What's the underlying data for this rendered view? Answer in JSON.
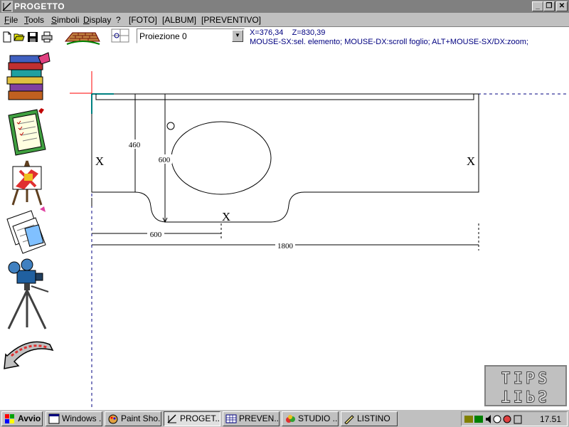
{
  "window": {
    "title": "PROGETTO",
    "minimize_glyph": "_",
    "restore_glyph": "❐",
    "close_glyph": "✕"
  },
  "menu": {
    "items": [
      {
        "label": "File"
      },
      {
        "label": "Tools"
      },
      {
        "label": "Simboli"
      },
      {
        "label": "Display"
      },
      {
        "label": "?"
      },
      {
        "label": "[FOTO]"
      },
      {
        "label": "[ALBUM]"
      },
      {
        "label": "[PREVENTIVO]"
      }
    ]
  },
  "toolbar": {
    "icons": [
      "new-file-icon",
      "open-folder-icon",
      "save-disk-icon",
      "print-icon",
      "brick-wall-icon",
      "projection-view-icon"
    ],
    "projection": "Proiezione 0"
  },
  "status": {
    "coords": "X=376,34    Z=830,39",
    "hint": "MOUSE-SX:sel. elemento; MOUSE-DX:scroll foglio; ALT+MOUSE-SX/DX:zoom;"
  },
  "sidebar": {
    "icons": [
      "catalog-books-icon",
      "clipboard-checklist-icon",
      "easel-drawing-icon",
      "papers-calculator-icon",
      "camera-tripod-icon",
      "back-arrow-icon"
    ]
  },
  "drawing": {
    "dim_460": "460",
    "dim_600_vertical": "600",
    "dim_600_horizontal": "600",
    "dim_1800": "1800",
    "marker": "X"
  },
  "logo_text": "TIPS",
  "taskbar": {
    "start": "Avvio",
    "tasks": [
      {
        "label": "Windows ..."
      },
      {
        "label": "Paint Sho..."
      },
      {
        "label": "PROGET..."
      },
      {
        "label": "PREVEN..."
      },
      {
        "label": "STUDIO ..."
      },
      {
        "label": "LISTINO"
      }
    ],
    "clock": "17.51"
  },
  "colors": {
    "accent_blue": "#000080",
    "title_gray": "#808080",
    "guide_red": "#ff0000",
    "guide_cyan": "#00ffff"
  }
}
